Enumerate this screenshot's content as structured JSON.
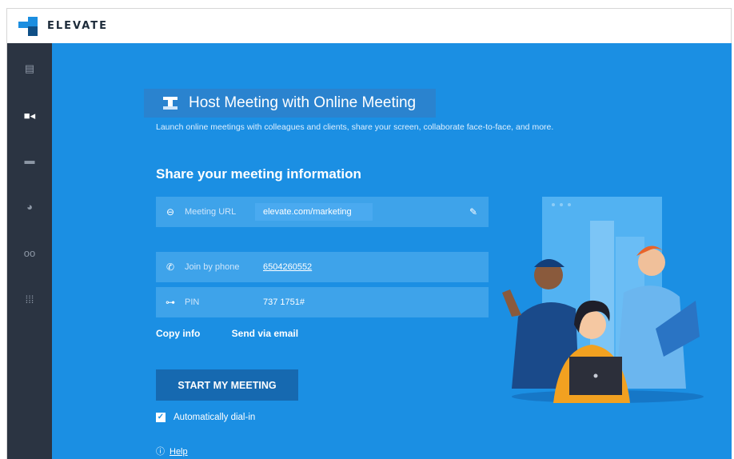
{
  "app": {
    "logo_text": "ELEVATE",
    "logo_color": "#1b8ee0"
  },
  "sidebar": {
    "items": [
      {
        "name": "chat-icon",
        "glyph": "▤",
        "active": false
      },
      {
        "name": "video-icon",
        "glyph": "■◂",
        "active": true
      },
      {
        "name": "folder-icon",
        "glyph": "▬",
        "active": false
      },
      {
        "name": "clock-icon",
        "glyph": "◕",
        "active": false
      },
      {
        "name": "voicemail-icon",
        "glyph": "oo",
        "active": false
      },
      {
        "name": "apps-grid-icon",
        "glyph": "⁞⁞⁞",
        "active": false
      }
    ]
  },
  "main": {
    "title": "Host Meeting with Online Meeting",
    "subtitle": "Launch online meetings with colleagues and clients, share your screen, collaborate face-to-face, and more.",
    "section_title": "Share your meeting information",
    "meeting_url": {
      "label": "Meeting URL",
      "value": "elevate.com/marketing",
      "icon": "link-icon",
      "edit_icon": "pencil-icon"
    },
    "phone": {
      "label": "Join by phone",
      "value": "6504260552",
      "icon": "phone-icon"
    },
    "pin": {
      "label": "PIN",
      "value": "737 1751#",
      "icon": "key-icon"
    },
    "copy_info": "Copy info",
    "send_email": "Send via email",
    "start_button": "START MY MEETING",
    "auto_dial": "Automatically dial-in",
    "auto_dial_checked": true,
    "help": "Help",
    "background_color": "#1b8fe3"
  }
}
